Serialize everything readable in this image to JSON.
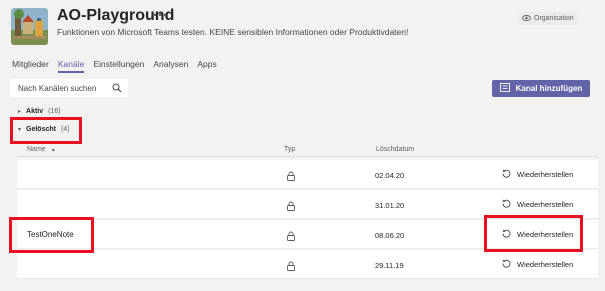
{
  "header": {
    "team_name": "AO-Playground",
    "more_glyph": "···",
    "description": "Funktionen von Microsoft Teams testen. KEINE sensiblen Informationen oder Produktivdaten!",
    "org_badge": "Organisation"
  },
  "tabs": [
    {
      "label": "Mitglieder"
    },
    {
      "label": "Kanäle"
    },
    {
      "label": "Einstellungen"
    },
    {
      "label": "Analysen"
    },
    {
      "label": "Apps"
    }
  ],
  "active_tab": "Kanäle",
  "search": {
    "placeholder": "Nach Kanälen suchen"
  },
  "add_channel_label": "Kanal hinzufügen",
  "sections": {
    "active": {
      "label": "Aktiv",
      "count": "(16)"
    },
    "deleted": {
      "label": "Gelöscht",
      "count": "(4)"
    }
  },
  "columns": {
    "name": "Name",
    "type": "Typ",
    "deleted_date": "Löschdatum"
  },
  "rows": [
    {
      "name": "",
      "date": "02.04.20",
      "restore": "Wiederherstellen"
    },
    {
      "name": "",
      "date": "31.01.20",
      "restore": "Wiederherstellen"
    },
    {
      "name": "TestOneNote",
      "date": "08.06.20",
      "restore": "Wiederherstellen"
    },
    {
      "name": "",
      "date": "29.11.19",
      "restore": "Wiederherstellen"
    }
  ],
  "colors": {
    "accent": "#6264a7",
    "highlight": "#e81123",
    "background": "#f3f2f1"
  },
  "icons": {
    "more": "more-options-icon",
    "org": "eye-icon",
    "search": "search-icon",
    "add": "channel-add-icon",
    "expand": "chevron-icon",
    "sort": "sort-arrow-icon",
    "lock": "lock-icon",
    "restore": "restore-icon"
  }
}
